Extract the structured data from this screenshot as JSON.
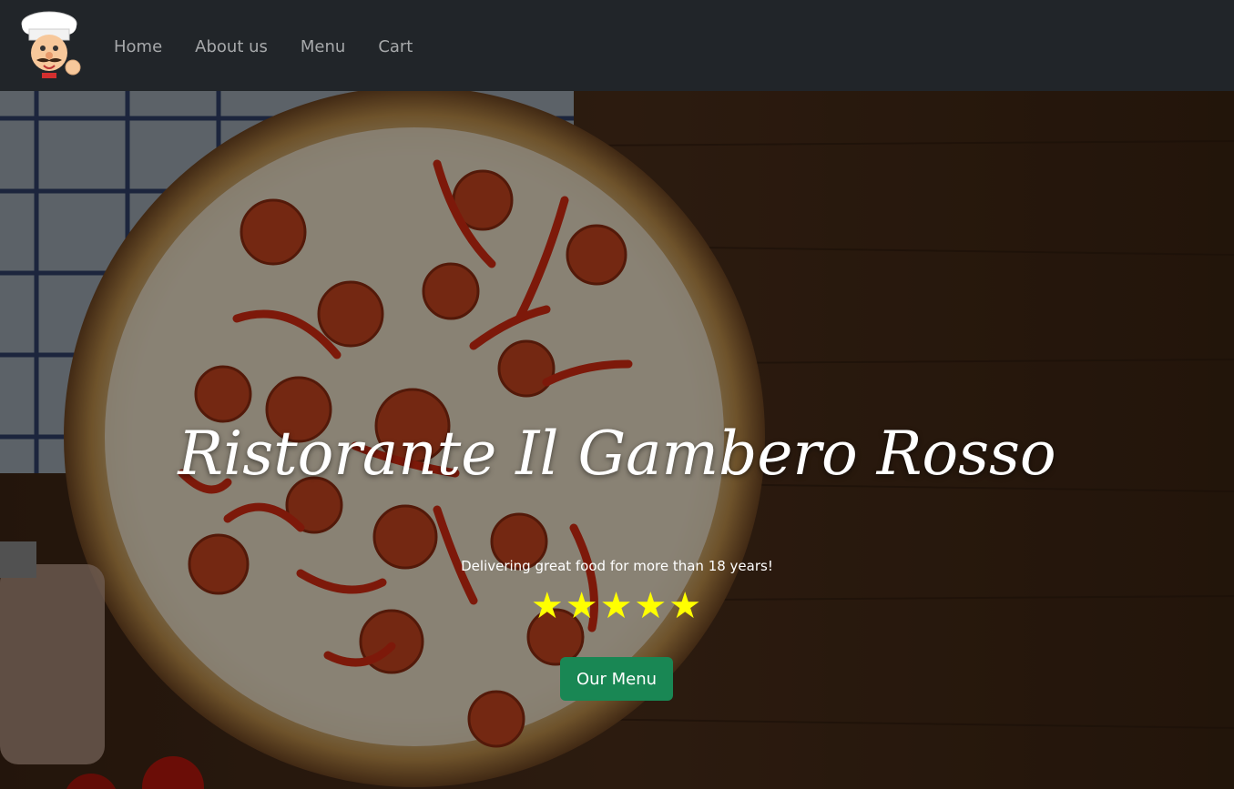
{
  "nav": {
    "logo": "chef-logo",
    "links": [
      {
        "label": "Home"
      },
      {
        "label": "About us"
      },
      {
        "label": "Menu"
      },
      {
        "label": "Cart"
      }
    ]
  },
  "hero": {
    "title": "Ristorante Il Gambero Rosso",
    "subtitle": "Delivering great food for more than 18 years!",
    "stars": "★★★★★",
    "rating": 5,
    "cta_label": "Our Menu",
    "background": "pizza-on-wooden-table",
    "colors": {
      "accent_green": "#198754",
      "star_yellow": "#ffff00",
      "navbar_bg": "#212529"
    }
  }
}
